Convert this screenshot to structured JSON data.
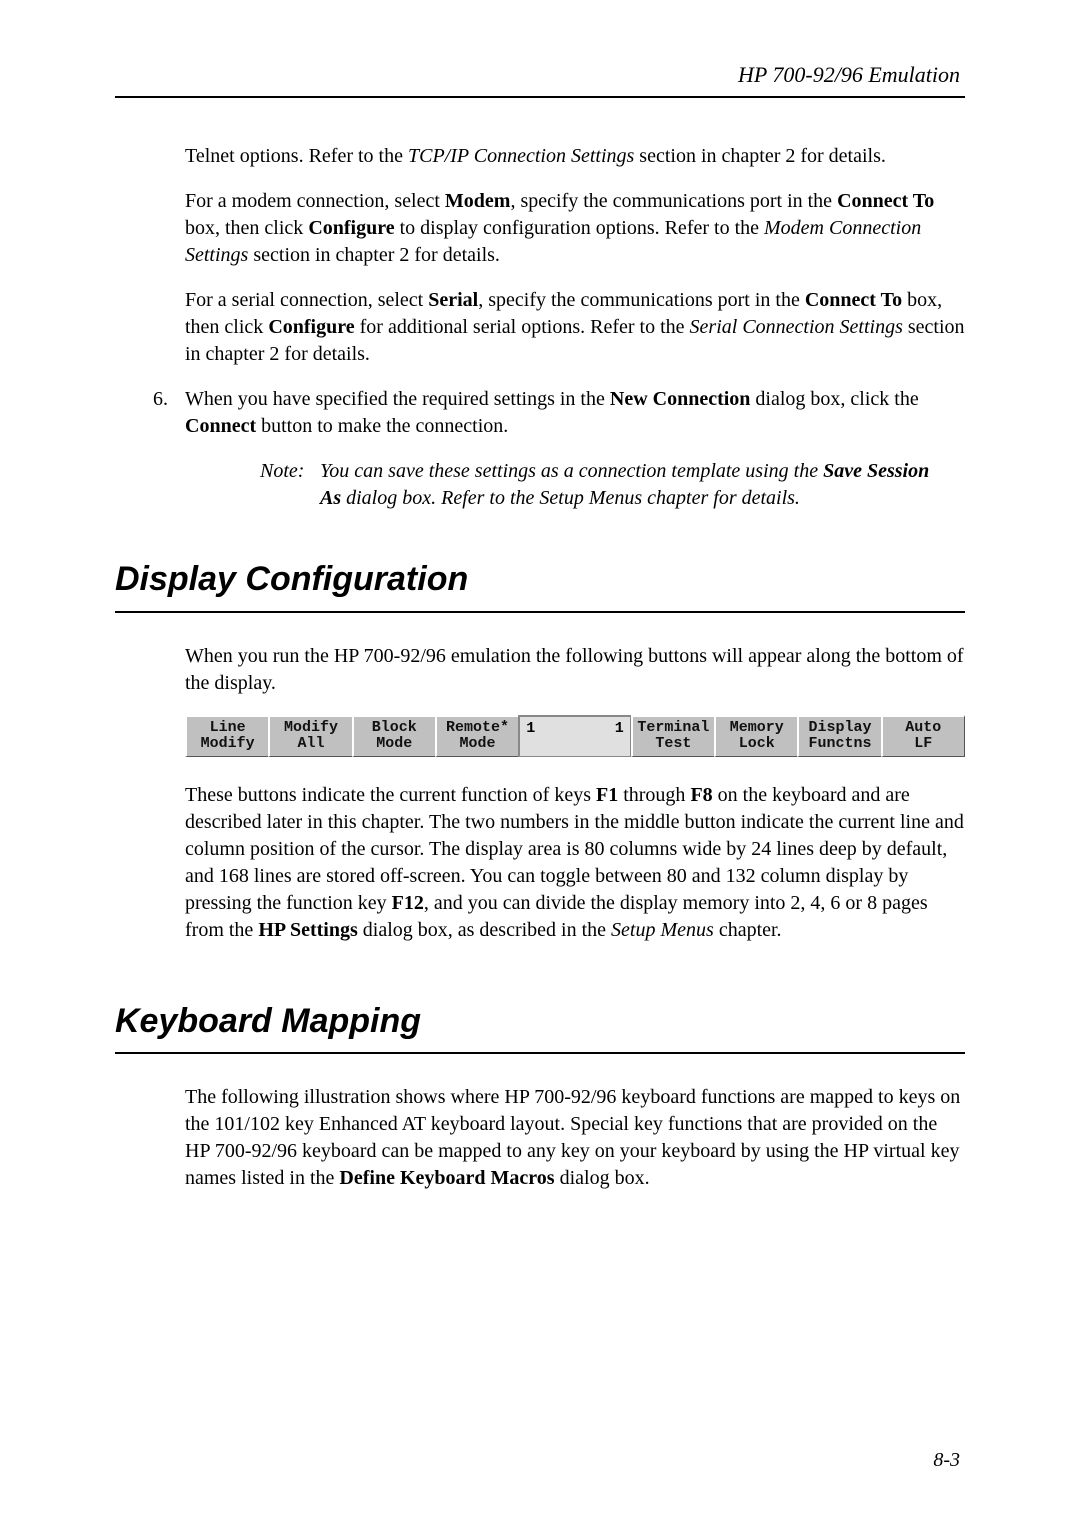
{
  "header": {
    "title": "HP 700-92/96 Emulation"
  },
  "intro": {
    "p1a": "Telnet options. Refer to the ",
    "p1b": "TCP/IP Connection Settings",
    "p1c": " section in chapter 2 for details.",
    "p2a": "For a modem connection, select ",
    "p2b": "Modem",
    "p2c": ", specify the communications port in the ",
    "p2d": "Connect To",
    "p2e": " box, then click ",
    "p2f": "Configure",
    "p2g": " to display configuration options. Refer to the ",
    "p2h": "Modem Connection Settings",
    "p2i": " section in chapter 2 for details.",
    "p3a": "For a serial connection, select ",
    "p3b": "Serial",
    "p3c": ", specify the communications port in the ",
    "p3d": "Connect To",
    "p3e": " box, then click ",
    "p3f": "Configure",
    "p3g": " for additional serial options. Refer to the ",
    "p3h": "Serial Connection Settings",
    "p3i": " section in chapter 2 for details."
  },
  "step6": {
    "number": "6.",
    "t1": "When you have specified the required settings in the ",
    "t2": "New Connection",
    "t3": " dialog box, click the ",
    "t4": "Connect",
    "t5": " button to make the connection."
  },
  "note": {
    "label": "Note:",
    "t1": "You can save these settings as a connection template using the ",
    "t2": "Save Session As",
    "t3": " dialog box. Refer to the Setup Menus chapter for details."
  },
  "section1": {
    "heading": "Display Configuration",
    "p1": "When you run the HP 700-92/96 emulation the following buttons will appear along the bottom of the display.",
    "buttons": {
      "f1": {
        "l1": "Line",
        "l2": "Modify"
      },
      "f2": {
        "l1": "Modify",
        "l2": "All"
      },
      "f3": {
        "l1": "Block",
        "l2": "Mode"
      },
      "f4": {
        "l1": "Remote*",
        "l2": "Mode"
      },
      "mid": {
        "left": "1",
        "right": "1"
      },
      "f5": {
        "l1": "Terminal",
        "l2": "Test"
      },
      "f6": {
        "l1": "Memory",
        "l2": "Lock"
      },
      "f7": {
        "l1": "Display",
        "l2": "Functns"
      },
      "f8": {
        "l1": "Auto",
        "l2": "LF"
      }
    },
    "p2a": "These buttons indicate the current function of keys ",
    "p2b": "F1",
    "p2c": " through ",
    "p2d": "F8",
    "p2e": " on the keyboard and are described later in this chapter. The two numbers in the middle button indicate the current line and column position of the cursor. The display area is 80 columns wide by 24 lines deep by default, and 168 lines are stored off-screen. You can toggle between 80 and 132 column display by pressing the function key ",
    "p2f": "F12",
    "p2g": ", and you can divide the display memory into 2, 4, 6 or 8 pages from the ",
    "p2h": "HP Settings",
    "p2i": " dialog box, as described in the ",
    "p2j": "Setup Menus",
    "p2k": " chapter."
  },
  "section2": {
    "heading": "Keyboard Mapping",
    "p1a": "The following illustration shows where HP 700-92/96 keyboard functions are mapped to keys on the 101/102 key Enhanced AT keyboard layout. Special key functions that are provided on the HP 700-92/96 keyboard can be mapped to any key on your keyboard by using the HP virtual key names listed in the ",
    "p1b": "Define Keyboard Macros",
    "p1c": " dialog box."
  },
  "pageNumber": "8-3"
}
